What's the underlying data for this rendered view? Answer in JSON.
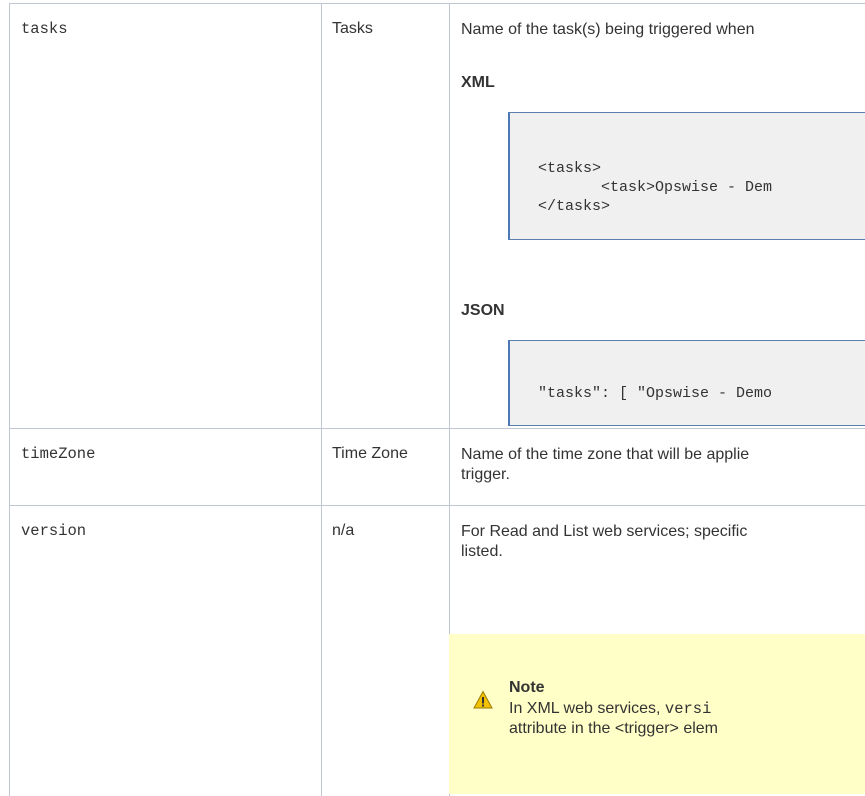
{
  "rows": [
    {
      "field": "tasks",
      "label": "Tasks",
      "description": "Name of the task(s) being triggered when",
      "xml_heading": "XML",
      "xml_code": [
        "<tasks>",
        "       <task>Opswise - Dem",
        "</tasks>"
      ],
      "json_heading": "JSON",
      "json_code": [
        "\"tasks\": [ \"Opswise - Demo"
      ]
    },
    {
      "field": "timeZone",
      "label": "Time Zone",
      "description_lines": [
        "Name of the time zone that will be applie",
        "trigger."
      ]
    },
    {
      "field": "version",
      "label": "n/a",
      "description_lines": [
        "For Read and List web services; specific",
        "listed."
      ],
      "note": {
        "icon": "warning-icon",
        "title": "Note",
        "line1_prefix": "In XML web services, ",
        "line1_code": "versi",
        "line2": "attribute in the <trigger> elem"
      }
    }
  ],
  "colors": {
    "border": "#c1c7d0",
    "code_bg": "#f0f0f0",
    "code_border": "#4a78b8",
    "note_bg": "#ffffc7",
    "warning": "#f2c200"
  }
}
